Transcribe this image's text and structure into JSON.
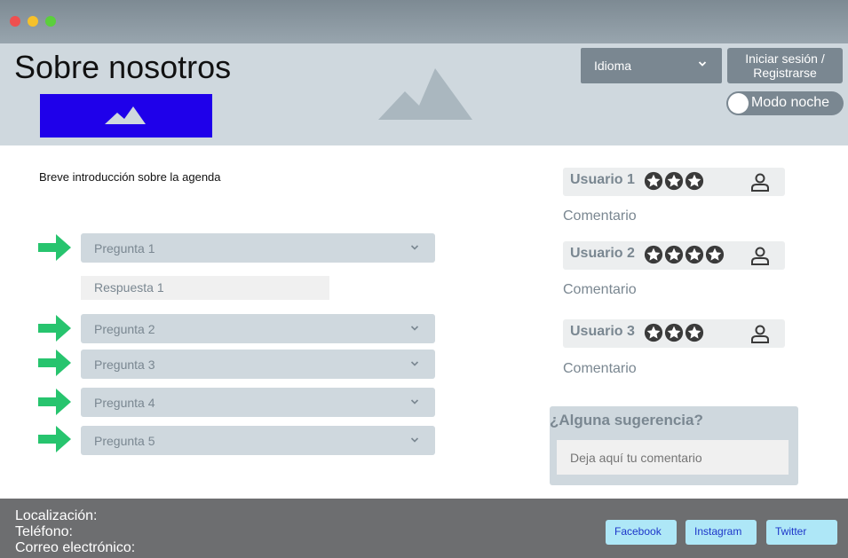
{
  "header": {
    "title": "Sobre nosotros",
    "language_label": "Idioma",
    "login_label": "Iniciar sesión / Registrarse",
    "night_mode_label": "Modo noche"
  },
  "intro": "Breve introducción sobre la agenda",
  "faq": [
    {
      "question": "Pregunta 1",
      "answer": "Respuesta 1",
      "expanded": true
    },
    {
      "question": "Pregunta 2"
    },
    {
      "question": "Pregunta 3"
    },
    {
      "question": "Pregunta 4"
    },
    {
      "question": "Pregunta 5"
    }
  ],
  "reviews": [
    {
      "user": "Usuario 1",
      "stars": 3,
      "comment": "Comentario"
    },
    {
      "user": "Usuario 2",
      "stars": 4,
      "comment": "Comentario"
    },
    {
      "user": "Usuario 3",
      "stars": 3,
      "comment": "Comentario"
    }
  ],
  "suggestion": {
    "title": "¿Alguna sugerencia?",
    "placeholder": "Deja aquí tu comentario"
  },
  "footer": {
    "location_label": "Localización:",
    "phone_label": "Teléfono:",
    "email_label": "Correo electrónico:",
    "social": [
      "Facebook",
      "Instagram",
      "Twitter"
    ]
  },
  "colors": {
    "header_bg": "#cfd8de",
    "control_bg": "#7a8791",
    "logo_bg": "#1f00ea",
    "arrow": "#27c46e",
    "footer_bg": "#6d6e70",
    "social_bg": "#aee7f7"
  }
}
